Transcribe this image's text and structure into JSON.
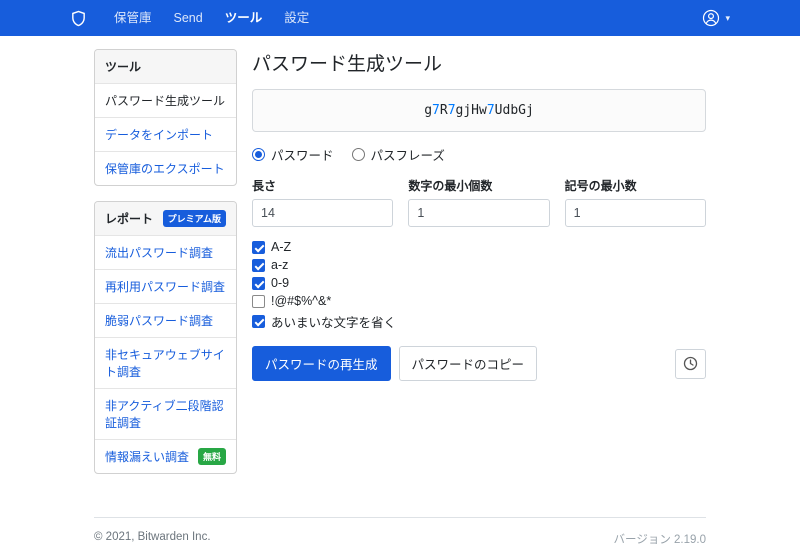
{
  "navbar": {
    "items": [
      {
        "label": "保管庫",
        "active": false
      },
      {
        "label": "Send",
        "active": false
      },
      {
        "label": "ツール",
        "active": true
      },
      {
        "label": "設定",
        "active": false
      }
    ]
  },
  "sidebar": {
    "tools": {
      "header": "ツール",
      "items": [
        {
          "label": "パスワード生成ツール",
          "active": true
        },
        {
          "label": "データをインポート",
          "active": false
        },
        {
          "label": "保管庫のエクスポート",
          "active": false
        }
      ]
    },
    "reports": {
      "header": "レポート",
      "header_badge": "プレミアム版",
      "items": [
        {
          "label": "流出パスワード調査",
          "badge": ""
        },
        {
          "label": "再利用パスワード調査",
          "badge": ""
        },
        {
          "label": "脆弱パスワード調査",
          "badge": ""
        },
        {
          "label": "非セキュアウェブサイト調査",
          "badge": ""
        },
        {
          "label": "非アクティブ二段階認証調査",
          "badge": ""
        },
        {
          "label": "情報漏えい調査",
          "badge": "無料"
        }
      ]
    }
  },
  "main": {
    "title": "パスワード生成ツール",
    "password": "g7R7gjHw7UdbGj",
    "type_options": [
      {
        "label": "パスワード",
        "selected": true
      },
      {
        "label": "パスフレーズ",
        "selected": false
      }
    ],
    "fields": [
      {
        "label": "長さ",
        "value": "14"
      },
      {
        "label": "数字の最小個数",
        "value": "1"
      },
      {
        "label": "記号の最小数",
        "value": "1"
      }
    ],
    "checkboxes": [
      {
        "label": "A-Z",
        "checked": true
      },
      {
        "label": "a-z",
        "checked": true
      },
      {
        "label": "0-9",
        "checked": true
      },
      {
        "label": "!@#$%^&*",
        "checked": false
      },
      {
        "label": "あいまいな文字を省く",
        "checked": true
      }
    ],
    "buttons": {
      "regenerate": "パスワードの再生成",
      "copy": "パスワードのコピー"
    }
  },
  "footer": {
    "copyright": "© 2021, Bitwarden Inc.",
    "version": "バージョン 2.19.0"
  },
  "colors": {
    "navbar_bg": "#175DDC",
    "link_blue": "#175DDC",
    "primary_button": "#175DDC",
    "free_badge_green": "#28a745",
    "password_digit_blue": "#007bff"
  }
}
